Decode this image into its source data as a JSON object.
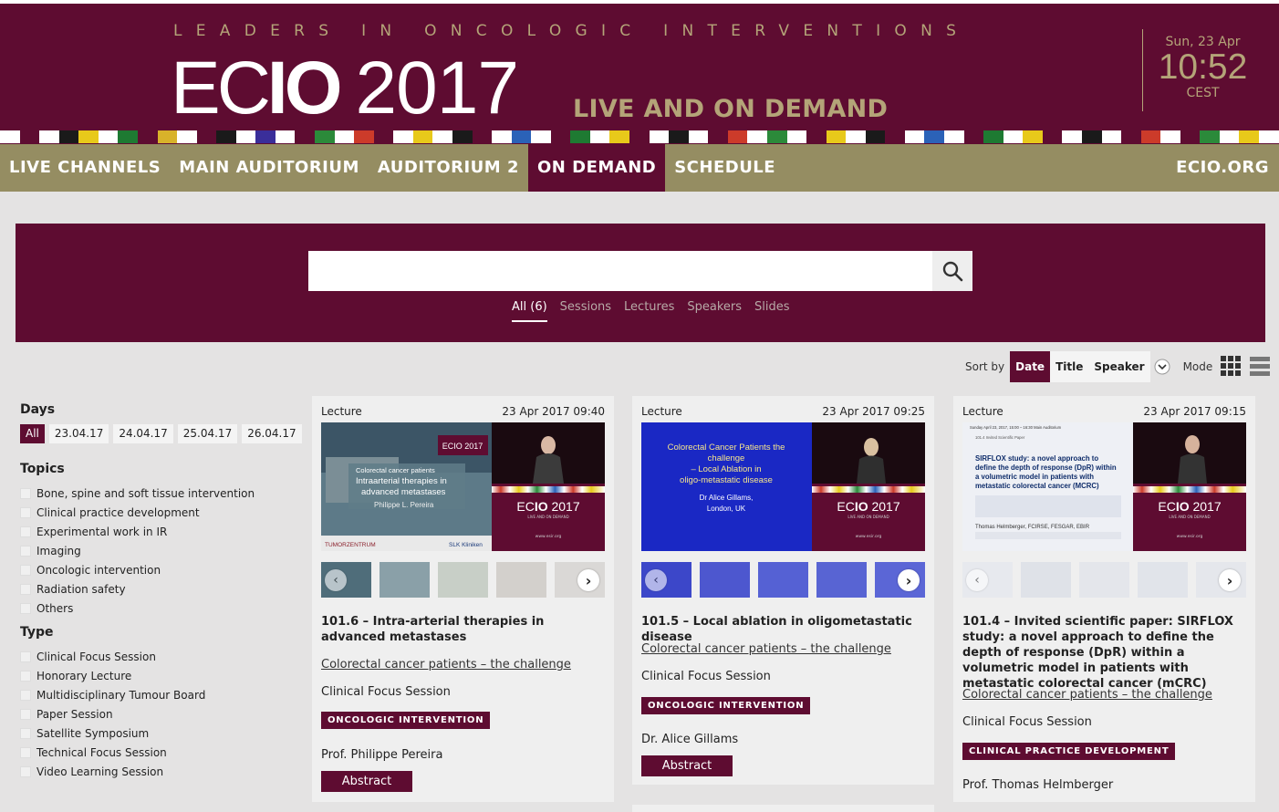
{
  "header": {
    "tagline": "LEADERS IN ONCOLOGIC INTERVENTIONS",
    "logo_ec": "EC",
    "logo_io": "IO",
    "logo_year": "2017",
    "live": "LIVE AND ON DEMAND",
    "clock": {
      "day": "Sun, 23 Apr",
      "time": "10:52",
      "tz": "CEST"
    },
    "stripe_colors": [
      "#ffffff",
      "#5e0c31",
      "#ffffff",
      "#1a1a1a",
      "#e8c91a",
      "#ffffff",
      "#1e7a32",
      "#5e0c31",
      "#d8b22a",
      "#ffffff",
      "#5e0c31",
      "#1a1a1a",
      "#ffffff",
      "#3a2e9a",
      "#ffffff",
      "#5e0c31",
      "#2b8a3a",
      "#ffffff",
      "#cc3b2a",
      "#5e0c31",
      "#ffffff",
      "#e8c91a",
      "#ffffff",
      "#1a1a1a",
      "#5e0c31",
      "#ffffff",
      "#2b62b8",
      "#ffffff",
      "#5e0c31",
      "#1e7a32",
      "#ffffff",
      "#e8c91a",
      "#5e0c31",
      "#ffffff",
      "#1a1a1a",
      "#ffffff",
      "#5e0c31",
      "#cc3b2a",
      "#ffffff",
      "#2b8a3a",
      "#ffffff",
      "#5e0c31",
      "#e8c91a",
      "#ffffff",
      "#1a1a1a",
      "#5e0c31",
      "#ffffff",
      "#2b62b8",
      "#ffffff",
      "#5e0c31",
      "#1e7a32",
      "#ffffff",
      "#e8c91a",
      "#5e0c31",
      "#ffffff",
      "#1a1a1a",
      "#ffffff",
      "#5e0c31",
      "#cc3b2a",
      "#ffffff",
      "#5e0c31",
      "#2b8a3a",
      "#ffffff",
      "#e8c91a",
      "#ffffff"
    ]
  },
  "nav": {
    "items": [
      "LIVE CHANNELS",
      "MAIN AUDITORIUM",
      "AUDITORIUM 2",
      "ON DEMAND",
      "SCHEDULE"
    ],
    "active_index": 3,
    "right": "ECIO.ORG"
  },
  "search": {
    "placeholder": "",
    "tabs": [
      "All (6)",
      "Sessions",
      "Lectures",
      "Speakers",
      "Slides"
    ]
  },
  "sort": {
    "label": "Sort by",
    "options": [
      "Date",
      "Title",
      "Speaker"
    ],
    "active": "Date",
    "mode_label": "Mode"
  },
  "filters": {
    "days_title": "Days",
    "days": [
      "All",
      "23.04.17",
      "24.04.17",
      "25.04.17",
      "26.04.17"
    ],
    "topics_title": "Topics",
    "topics": [
      "Bone, spine and soft tissue intervention",
      "Clinical practice development",
      "Experimental work in IR",
      "Imaging",
      "Oncologic intervention",
      "Radiation safety",
      "Others"
    ],
    "type_title": "Type",
    "types": [
      "Clinical Focus Session",
      "Honorary Lecture",
      "Multidisciplinary Tumour Board",
      "Paper Session",
      "Satellite Symposium",
      "Technical Focus Session",
      "Video Learning Session"
    ]
  },
  "cards": [
    {
      "type": "Lecture",
      "date": "23 Apr 2017 09:40",
      "title": "101.6 – Intra-arterial therapies in advanced metastases",
      "link": "Colorectal cancer patients – the challenge",
      "session": "Clinical Focus Session",
      "badge": "ONCOLOGIC INTERVENTION",
      "speaker": "Prof. Philippe Pereira",
      "abstract": "Abstract",
      "slide": {
        "title": "Colorectal cancer patients\nIntraarterial therapies in\nadvanced metastases",
        "name": "Philippe L. Pereira",
        "logo_left": "TUMORZENTRUM",
        "logo_right": "SLK Kliniken"
      }
    },
    {
      "type": "Lecture",
      "date": "23 Apr 2017 09:25",
      "title": "101.5 – Local ablation in oligometastatic disease",
      "link": "Colorectal cancer patients – the challenge",
      "session": "Clinical Focus Session",
      "badge": "ONCOLOGIC INTERVENTION",
      "speaker": "Dr. Alice Gillams",
      "abstract": "Abstract",
      "slide": {
        "title": "Colorectal Cancer Patients the challenge\n– Local Ablation in\noligo-metastatic disease",
        "name": "Dr Alice Gillams,\nLondon, UK"
      }
    },
    {
      "type": "Lecture",
      "date": "23 Apr 2017 09:15",
      "title": "101.4 – Invited scientific paper: SIRFLOX study: a novel approach to define the depth of response (DpR) within a volumetric model in patients with metastatic colorectal cancer (mCRC)",
      "link": "Colorectal cancer patients – the challenge",
      "session": "Clinical Focus Session",
      "badge": "CLINICAL PRACTICE DEVELOPMENT",
      "speaker": "Prof. Thomas Helmberger",
      "slide": {
        "header": "Sunday April 23, 2017, 15:00 – 16:30 Main Auditorium",
        "sub": "101.4 Invited Scientific Paper",
        "title": "SIRFLOX study: a novel approach to define the depth of response (DpR) within a volumetric model in patients with metastatic colorectal cancer (MCRC)",
        "name": "Thomas Helmberger, FCIRSE, FESGAR, EBIR"
      }
    }
  ],
  "video_panel": {
    "logo_ec": "EC",
    "logo_io": "IO",
    "logo_year": "2017",
    "sub": "LIVE AND ON DEMAND",
    "url": "www.esir.org"
  }
}
